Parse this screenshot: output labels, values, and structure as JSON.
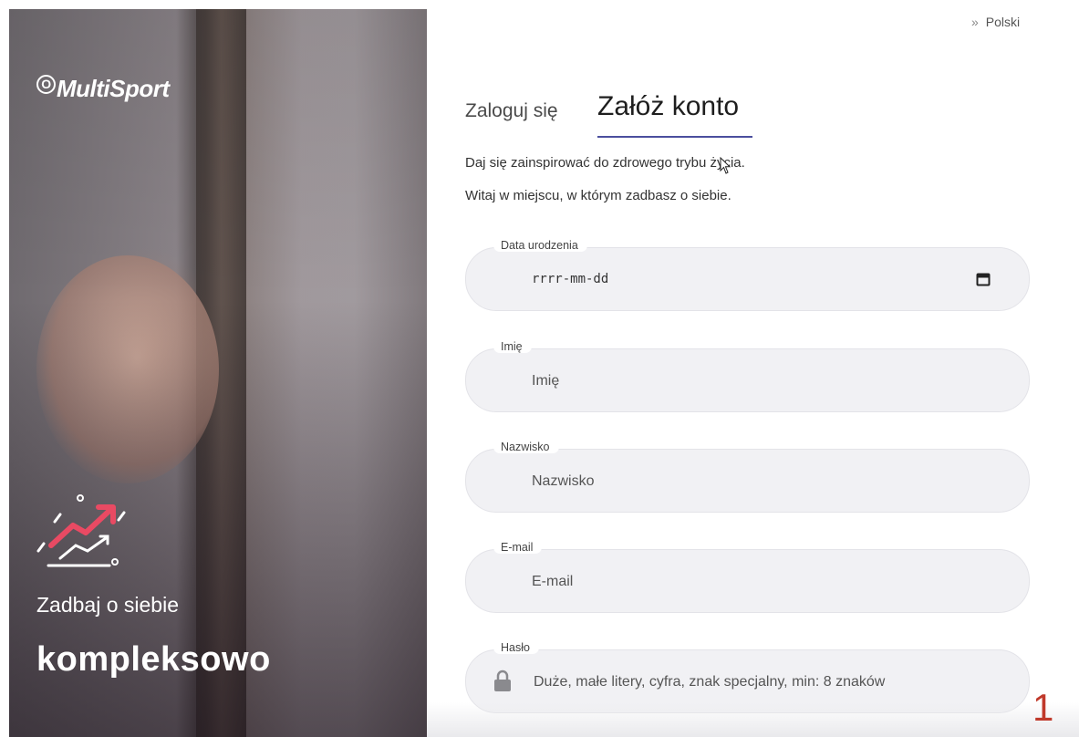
{
  "hero": {
    "logo_text": "MultiSport",
    "logo_mark": "O",
    "tagline": "Zadbaj o siebie",
    "headline": "kompleksowo",
    "icon": "trend-up-chart-icon"
  },
  "language": {
    "arrows": "»",
    "label": "Polski"
  },
  "tabs": {
    "login": "Zaloguj się",
    "register": "Załóż konto",
    "active": "register"
  },
  "intro": {
    "line1": "Daj się zainspirować do zdrowego trybu życia.",
    "line2": "Witaj w miejscu, w którym zadbasz o siebie."
  },
  "form": {
    "birthdate": {
      "label": "Data urodzenia",
      "placeholder": "rrrr-mm-dd",
      "icon": "calendar-icon"
    },
    "first_name": {
      "label": "Imię",
      "placeholder": "Imię"
    },
    "last_name": {
      "label": "Nazwisko",
      "placeholder": "Nazwisko"
    },
    "email": {
      "label": "E-mail",
      "placeholder": "E-mail"
    },
    "password": {
      "label": "Hasło",
      "placeholder": "Duże, małe litery, cyfra, znak specjalny, min: 8 znaków",
      "icon": "lock-icon"
    }
  },
  "page_number": "1",
  "colors": {
    "accent": "#4b4f9e",
    "page_number": "#c0392b",
    "field_bg": "#f1f1f4"
  }
}
